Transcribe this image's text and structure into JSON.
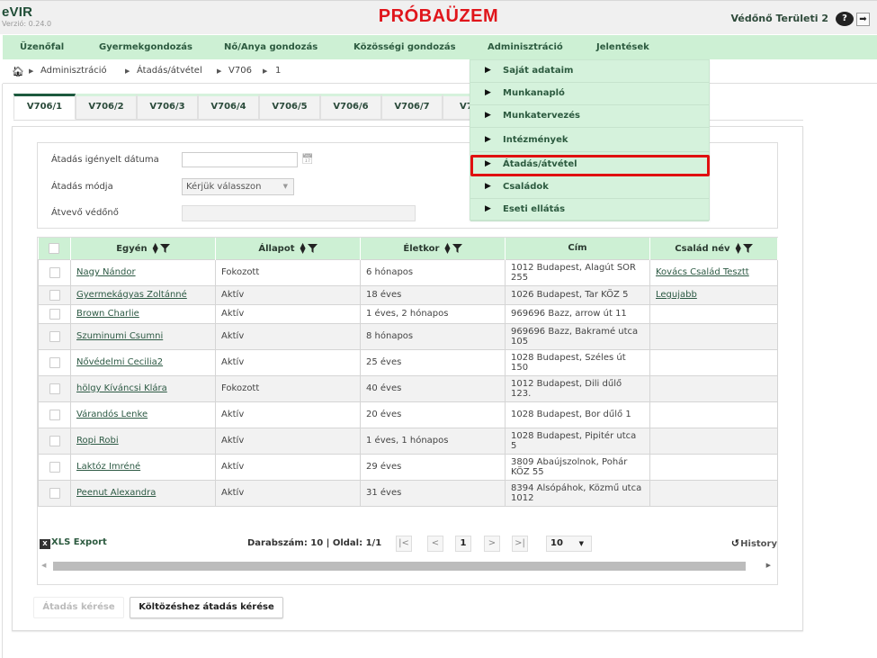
{
  "header": {
    "app_name": "eVIR",
    "version": "Verzió: 0.24.0",
    "banner": "PRÓBAÜZEM",
    "user": "Védőnő Területi 2",
    "help_icon": "?",
    "logout_icon": "➡"
  },
  "menu": {
    "items": [
      {
        "label": "Üzenőfal"
      },
      {
        "label": "Gyermekgondozás"
      },
      {
        "label": "Nő/Anya gondozás"
      },
      {
        "label": "Közösségi gondozás"
      },
      {
        "label": "Adminisztráció"
      },
      {
        "label": "Jelentések"
      }
    ],
    "open_menu": "Adminisztráció",
    "dropdown": [
      {
        "label": "Saját adataim"
      },
      {
        "label": "Munkanapló"
      },
      {
        "label": "Munkatervezés"
      },
      {
        "label": "Intézmények"
      },
      {
        "label": "Átadás/átvétel"
      },
      {
        "label": "Családok"
      },
      {
        "label": "Eseti ellátás"
      }
    ],
    "highlighted_item": "Átadás/átvétel",
    "highlight_color": "#e01010"
  },
  "breadcrumb": {
    "home_icon": "home-icon",
    "items": [
      "Adminisztráció",
      "Átadás/átvétel",
      "V706",
      "1"
    ]
  },
  "tabs": [
    {
      "label": "V706/1",
      "active": true
    },
    {
      "label": "V706/2"
    },
    {
      "label": "V706/3"
    },
    {
      "label": "V706/4"
    },
    {
      "label": "V706/5"
    },
    {
      "label": "V706/6"
    },
    {
      "label": "V706/7"
    },
    {
      "label": "V7"
    }
  ],
  "form": {
    "date_label": "Átadás igényelt dátuma",
    "date_value": "",
    "mode_label": "Átadás módja",
    "mode_value": "Kérjük válasszon",
    "receiver_label": "Átvevő védőnő",
    "receiver_value": ""
  },
  "table": {
    "columns": [
      "Egyén",
      "Állapot",
      "Életkor",
      "Cím",
      "Család név"
    ],
    "rows": [
      {
        "name": "Nagy Nándor",
        "status": "Fokozott",
        "age": "6 hónapos",
        "address": "1012 Budapest, Alagút SOR 255",
        "family": "Kovács Család Tesztt"
      },
      {
        "name": "Gyermekágyas Zoltánné",
        "status": "Aktív",
        "age": "18 éves",
        "address": "1026 Budapest, Tar KÖZ 5",
        "family": "Legujabb"
      },
      {
        "name": "Brown Charlie",
        "status": "Aktív",
        "age": "1 éves, 2 hónapos",
        "address": "969696 Bazz, arrow út 11",
        "family": ""
      },
      {
        "name": "Szuminumi Csumni",
        "status": "Aktív",
        "age": "8 hónapos",
        "address": "969696 Bazz, Bakramé utca 105",
        "family": ""
      },
      {
        "name": "Nővédelmi Cecilia2",
        "status": "Aktív",
        "age": "25 éves",
        "address": "1028 Budapest, Széles út 150",
        "family": ""
      },
      {
        "name": "hölgy Kíváncsi Klára",
        "status": "Fokozott",
        "age": "40 éves",
        "address": "1012 Budapest, Dili dűlő 123.",
        "family": ""
      },
      {
        "name": "Várandós Lenke",
        "status": "Aktív",
        "age": "20 éves",
        "address": "1028 Budapest, Bor dűlő 1",
        "family": ""
      },
      {
        "name": "Ropi Robi",
        "status": "Aktív",
        "age": "1 éves, 1 hónapos",
        "address": "1028 Budapest, Pipitér utca 5",
        "family": ""
      },
      {
        "name": "Laktóz Imréné",
        "status": "Aktív",
        "age": "29 éves",
        "address": "3809 Abaújszolnok, Pohár KÖZ 55",
        "family": ""
      },
      {
        "name": "Peenut Alexandra",
        "status": "Aktív",
        "age": "31 éves",
        "address": "8394 Alsópáhok, Közmű utca 1012",
        "family": ""
      }
    ]
  },
  "pager": {
    "xls_label": "XLS Export",
    "count_text": "Darabszám: 10 | Oldal: 1/1",
    "first": "|<",
    "prev": "<",
    "current_page": "1",
    "next": ">",
    "last": ">|",
    "page_size": "10",
    "history_label": "History"
  },
  "buttons": {
    "request_label": "Átadás kérése",
    "move_request_label": "Költözéshez átadás kérése"
  }
}
